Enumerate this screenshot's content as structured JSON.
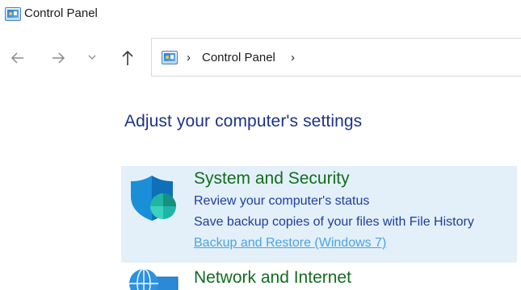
{
  "window": {
    "title": "Control Panel",
    "icon": "control-panel-icon"
  },
  "nav": {
    "back_icon": "arrow-left-icon",
    "forward_icon": "arrow-right-icon",
    "recent_icon": "chevron-down-icon",
    "up_icon": "arrow-up-icon"
  },
  "address": {
    "icon": "control-panel-icon",
    "breadcrumb": [
      "Control Panel"
    ],
    "separator": "›"
  },
  "main": {
    "heading": "Adjust your computer's settings",
    "categories": [
      {
        "title": "System and Security",
        "icon": "shield-icon",
        "links": [
          "Review your computer's status",
          "Save backup copies of your files with File History",
          "Backup and Restore (Windows 7)"
        ],
        "highlighted": true
      },
      {
        "title": "Network and Internet",
        "icon": "globe-icon",
        "links": []
      }
    ]
  },
  "colors": {
    "heading": "#1e3287",
    "category_title": "#136c1e",
    "link": "#1e3c9e",
    "link_hover": "#4ba3e3",
    "highlight_bg": "#e3f0fa"
  }
}
